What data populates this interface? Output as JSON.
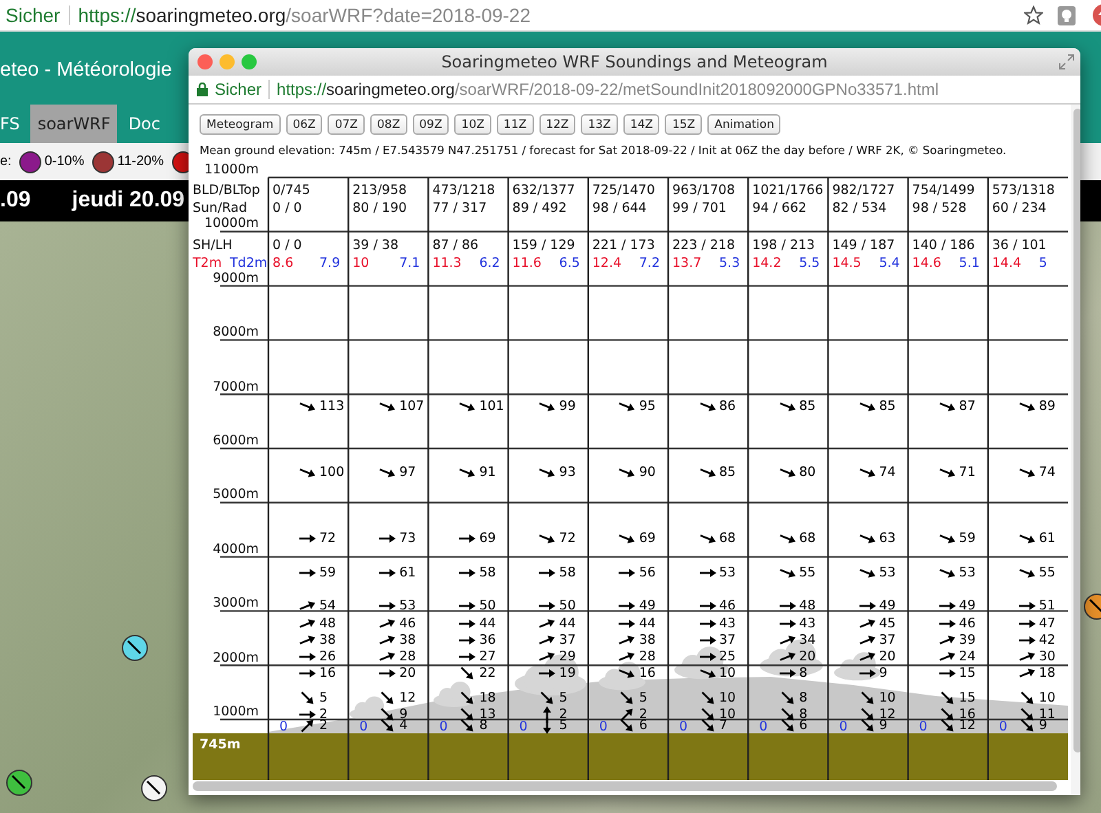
{
  "browser": {
    "security": "Sicher",
    "url": {
      "scheme": "https://",
      "host": "soaringmeteo.org",
      "path": "/soarWRF?date=2018-09-22"
    }
  },
  "page": {
    "title": "eteo - Météorologie",
    "tabs": [
      {
        "label": "FS",
        "selected": false
      },
      {
        "label": "soarWRF",
        "selected": true
      },
      {
        "label": "Doc",
        "selected": false
      }
    ],
    "legend_label": "e:",
    "legend": [
      {
        "label": "0-10%",
        "color": "#8b1a8b"
      },
      {
        "label": "11-20%",
        "color": "#9b3535"
      },
      {
        "color": "#d41111"
      }
    ],
    "days": [
      ".09",
      "jeudi 20.09"
    ]
  },
  "popup": {
    "title": "Soaringmeteo WRF Soundings and Meteogram",
    "security": "Sicher",
    "url": {
      "scheme": "https://",
      "host": "soaringmeteo.org",
      "path": "/soarWRF/2018-09-22/metSoundInit2018092000GPNo33571.html"
    },
    "buttons": [
      "Meteogram",
      "06Z",
      "07Z",
      "08Z",
      "09Z",
      "10Z",
      "11Z",
      "12Z",
      "13Z",
      "14Z",
      "15Z",
      "Animation"
    ],
    "info": "Mean ground elevation: 745m / E7.543579 N47.251751 / forecast for Sat 2018-09-22 / Init at 06Z the day before / WRF 2K, © Soaringmeteo.",
    "row_labels": {
      "bld": "BLD/BLTop",
      "sun": "Sun/Rad",
      "sh": "SH/LH",
      "t2m": "T2m",
      "td2m": "Td2m"
    },
    "altitudes": [
      "11000m",
      "10000m",
      "9000m",
      "8000m",
      "7000m",
      "6000m",
      "5000m",
      "4000m",
      "3000m",
      "2000m",
      "1000m"
    ],
    "ground_label": "745m",
    "columns": [
      {
        "bld": "0/745",
        "sun": "0 / 0",
        "sh": "0 / 0",
        "t2m": "8.6",
        "td2m": "7.9",
        "ground": "0",
        "winds": [
          {
            "speed": "113",
            "kind": "ese"
          },
          {
            "speed": "100",
            "kind": "ese"
          },
          {
            "speed": "72",
            "kind": "e"
          },
          {
            "speed": "59",
            "kind": "e"
          },
          {
            "speed": "54",
            "kind": "ene"
          },
          {
            "speed": "48",
            "kind": "ene"
          },
          {
            "speed": "38",
            "kind": "ene"
          },
          {
            "speed": "26",
            "kind": "e"
          },
          {
            "speed": "16",
            "kind": "e"
          },
          {
            "speed": "5",
            "kind": "se"
          },
          {
            "speed": "2",
            "kind": "e"
          },
          {
            "speed": "2",
            "kind": "ne"
          }
        ]
      },
      {
        "bld": "213/958",
        "sun": "80 / 190",
        "sh": "39 / 38",
        "t2m": "10",
        "td2m": "7.1",
        "ground": "0",
        "winds": [
          {
            "speed": "107",
            "kind": "ese"
          },
          {
            "speed": "97",
            "kind": "ese"
          },
          {
            "speed": "73",
            "kind": "e"
          },
          {
            "speed": "61",
            "kind": "e"
          },
          {
            "speed": "53",
            "kind": "e"
          },
          {
            "speed": "46",
            "kind": "ene"
          },
          {
            "speed": "38",
            "kind": "ene"
          },
          {
            "speed": "28",
            "kind": "ene"
          },
          {
            "speed": "20",
            "kind": "e"
          },
          {
            "speed": "12",
            "kind": "se"
          },
          {
            "speed": "9",
            "kind": "se"
          },
          {
            "speed": "4",
            "kind": "se"
          }
        ]
      },
      {
        "bld": "473/1218",
        "sun": "77 / 317",
        "sh": "87 / 86",
        "t2m": "11.3",
        "td2m": "6.2",
        "ground": "0",
        "winds": [
          {
            "speed": "101",
            "kind": "ese"
          },
          {
            "speed": "91",
            "kind": "ese"
          },
          {
            "speed": "69",
            "kind": "e"
          },
          {
            "speed": "58",
            "kind": "e"
          },
          {
            "speed": "50",
            "kind": "e"
          },
          {
            "speed": "44",
            "kind": "e"
          },
          {
            "speed": "36",
            "kind": "e"
          },
          {
            "speed": "27",
            "kind": "e"
          },
          {
            "speed": "22",
            "kind": "se"
          },
          {
            "speed": "18",
            "kind": "se"
          },
          {
            "speed": "13",
            "kind": "se"
          },
          {
            "speed": "8",
            "kind": "se"
          }
        ]
      },
      {
        "bld": "632/1377",
        "sun": "89 / 492",
        "sh": "159 / 129",
        "t2m": "11.6",
        "td2m": "6.5",
        "ground": "0",
        "winds": [
          {
            "speed": "99",
            "kind": "ese"
          },
          {
            "speed": "93",
            "kind": "ese"
          },
          {
            "speed": "72",
            "kind": "ese"
          },
          {
            "speed": "58",
            "kind": "e"
          },
          {
            "speed": "50",
            "kind": "e"
          },
          {
            "speed": "44",
            "kind": "ene"
          },
          {
            "speed": "37",
            "kind": "ene"
          },
          {
            "speed": "29",
            "kind": "ene"
          },
          {
            "speed": "19",
            "kind": "e"
          },
          {
            "speed": "5",
            "kind": "se"
          },
          {
            "speed": "2",
            "kind": "n"
          },
          {
            "speed": "5",
            "kind": "s"
          }
        ]
      },
      {
        "bld": "725/1470",
        "sun": "98 / 644",
        "sh": "221 / 173",
        "t2m": "12.4",
        "td2m": "7.2",
        "ground": "0",
        "winds": [
          {
            "speed": "95",
            "kind": "ese"
          },
          {
            "speed": "90",
            "kind": "ese"
          },
          {
            "speed": "69",
            "kind": "ese"
          },
          {
            "speed": "56",
            "kind": "e"
          },
          {
            "speed": "49",
            "kind": "e"
          },
          {
            "speed": "44",
            "kind": "e"
          },
          {
            "speed": "38",
            "kind": "ene"
          },
          {
            "speed": "28",
            "kind": "ene"
          },
          {
            "speed": "16",
            "kind": "ese"
          },
          {
            "speed": "5",
            "kind": "se"
          },
          {
            "speed": "2",
            "kind": "ne"
          },
          {
            "speed": "6",
            "kind": "se"
          }
        ]
      },
      {
        "bld": "963/1708",
        "sun": "99 / 701",
        "sh": "223 / 218",
        "t2m": "13.7",
        "td2m": "5.3",
        "ground": "0",
        "winds": [
          {
            "speed": "86",
            "kind": "ese"
          },
          {
            "speed": "85",
            "kind": "ese"
          },
          {
            "speed": "68",
            "kind": "ese"
          },
          {
            "speed": "53",
            "kind": "e"
          },
          {
            "speed": "46",
            "kind": "e"
          },
          {
            "speed": "43",
            "kind": "e"
          },
          {
            "speed": "37",
            "kind": "e"
          },
          {
            "speed": "25",
            "kind": "e"
          },
          {
            "speed": "10",
            "kind": "ese"
          },
          {
            "speed": "10",
            "kind": "se"
          },
          {
            "speed": "10",
            "kind": "se"
          },
          {
            "speed": "7",
            "kind": "se"
          }
        ]
      },
      {
        "bld": "1021/1766",
        "sun": "94 / 662",
        "sh": "198 / 213",
        "t2m": "14.2",
        "td2m": "5.5",
        "ground": "0",
        "winds": [
          {
            "speed": "85",
            "kind": "ese"
          },
          {
            "speed": "80",
            "kind": "ese"
          },
          {
            "speed": "68",
            "kind": "ese"
          },
          {
            "speed": "55",
            "kind": "ese"
          },
          {
            "speed": "48",
            "kind": "e"
          },
          {
            "speed": "43",
            "kind": "e"
          },
          {
            "speed": "34",
            "kind": "ene"
          },
          {
            "speed": "20",
            "kind": "ene"
          },
          {
            "speed": "8",
            "kind": "e"
          },
          {
            "speed": "8",
            "kind": "se"
          },
          {
            "speed": "8",
            "kind": "se"
          },
          {
            "speed": "6",
            "kind": "se"
          }
        ]
      },
      {
        "bld": "982/1727",
        "sun": "82 / 534",
        "sh": "149 / 187",
        "t2m": "14.5",
        "td2m": "5.4",
        "ground": "0",
        "winds": [
          {
            "speed": "85",
            "kind": "ese"
          },
          {
            "speed": "74",
            "kind": "ese"
          },
          {
            "speed": "63",
            "kind": "ese"
          },
          {
            "speed": "53",
            "kind": "ese"
          },
          {
            "speed": "49",
            "kind": "e"
          },
          {
            "speed": "45",
            "kind": "ene"
          },
          {
            "speed": "37",
            "kind": "ene"
          },
          {
            "speed": "20",
            "kind": "ene"
          },
          {
            "speed": "9",
            "kind": "e"
          },
          {
            "speed": "10",
            "kind": "se"
          },
          {
            "speed": "12",
            "kind": "se"
          },
          {
            "speed": "9",
            "kind": "se"
          }
        ]
      },
      {
        "bld": "754/1499",
        "sun": "98 / 528",
        "sh": "140 / 186",
        "t2m": "14.6",
        "td2m": "5.1",
        "ground": "0",
        "winds": [
          {
            "speed": "87",
            "kind": "ese"
          },
          {
            "speed": "71",
            "kind": "ese"
          },
          {
            "speed": "59",
            "kind": "ese"
          },
          {
            "speed": "53",
            "kind": "ese"
          },
          {
            "speed": "49",
            "kind": "e"
          },
          {
            "speed": "46",
            "kind": "e"
          },
          {
            "speed": "39",
            "kind": "ene"
          },
          {
            "speed": "24",
            "kind": "ene"
          },
          {
            "speed": "15",
            "kind": "e"
          },
          {
            "speed": "15",
            "kind": "se"
          },
          {
            "speed": "16",
            "kind": "se"
          },
          {
            "speed": "12",
            "kind": "se"
          }
        ]
      },
      {
        "bld": "573/1318",
        "sun": "60 / 234",
        "sh": "36 / 101",
        "t2m": "14.4",
        "td2m": "5",
        "ground": "0",
        "winds": [
          {
            "speed": "89",
            "kind": "ese"
          },
          {
            "speed": "74",
            "kind": "ese"
          },
          {
            "speed": "61",
            "kind": "ese"
          },
          {
            "speed": "55",
            "kind": "ese"
          },
          {
            "speed": "51",
            "kind": "e"
          },
          {
            "speed": "47",
            "kind": "e"
          },
          {
            "speed": "42",
            "kind": "e"
          },
          {
            "speed": "30",
            "kind": "ene"
          },
          {
            "speed": "18",
            "kind": "ene"
          },
          {
            "speed": "10",
            "kind": "se"
          },
          {
            "speed": "11",
            "kind": "se"
          },
          {
            "speed": "9",
            "kind": "se"
          }
        ]
      }
    ]
  }
}
